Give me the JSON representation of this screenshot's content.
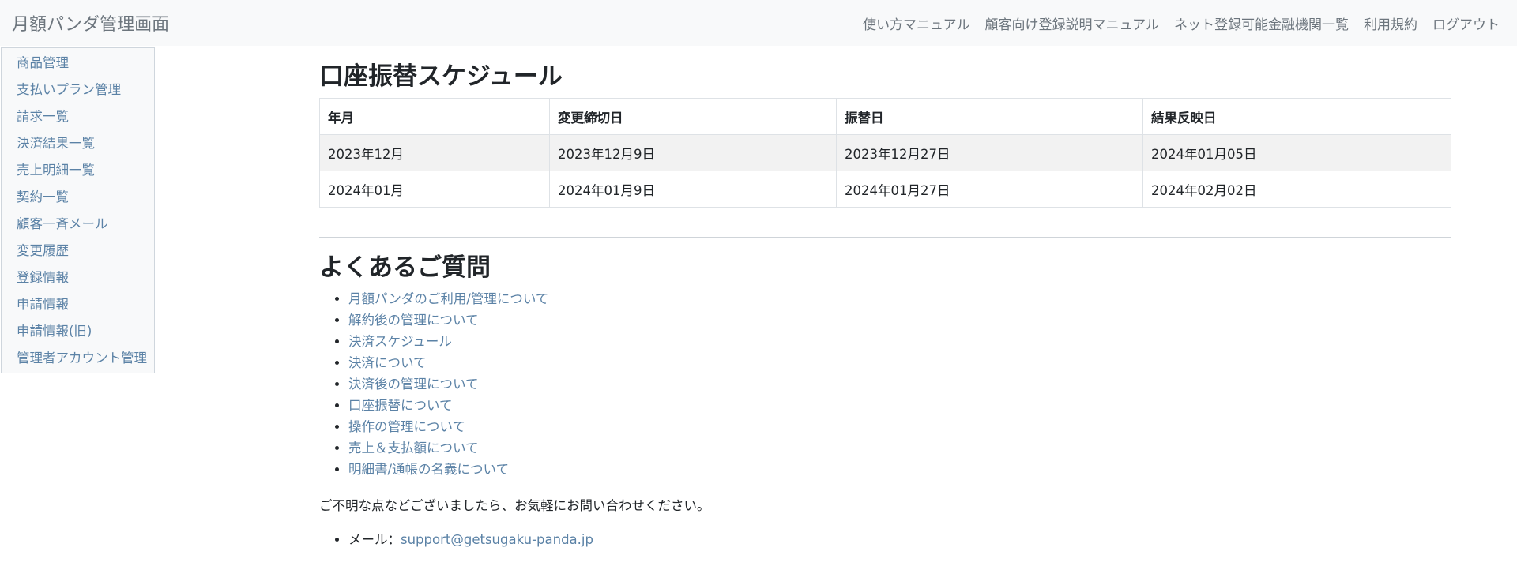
{
  "navbar": {
    "brand": "月額パンダ管理画面",
    "links": [
      "使い方マニュアル",
      "顧客向け登録説明マニュアル",
      "ネット登録可能金融機関一覧",
      "利用規約",
      "ログアウト"
    ]
  },
  "sidebar": {
    "items": [
      "商品管理",
      "支払いプラン管理",
      "請求一覧",
      "決済結果一覧",
      "売上明細一覧",
      "契約一覧",
      "顧客一斉メール",
      "変更履歴",
      "登録情報",
      "申請情報",
      "申請情報(旧)",
      "管理者アカウント管理"
    ]
  },
  "schedule": {
    "title": "口座振替スケジュール",
    "headers": [
      "年月",
      "変更締切日",
      "振替日",
      "結果反映日"
    ],
    "rows": [
      [
        "2023年12月",
        "2023年12月9日",
        "2023年12月27日",
        "2024年01月05日"
      ],
      [
        "2024年01月",
        "2024年01月9日",
        "2024年01月27日",
        "2024年02月02日"
      ]
    ]
  },
  "faq": {
    "title": "よくあるご質問",
    "items": [
      "月額パンダのご利用/管理について",
      "解約後の管理について",
      "決済スケジュール",
      "決済について",
      "決済後の管理について",
      "口座振替について",
      "操作の管理について",
      "売上＆支払額について",
      "明細書/通帳の名義について"
    ]
  },
  "contact": {
    "note": "ご不明な点などございましたら、お気軽にお問い合わせください。",
    "mail_label": "メール：",
    "mail_address": "support@getsugaku-panda.jp"
  },
  "colors": {
    "navbar_bg": "#f8f9fa",
    "link": "#5b82a6",
    "nav_text": "#6c757d",
    "stripe": "#f2f2f2"
  }
}
